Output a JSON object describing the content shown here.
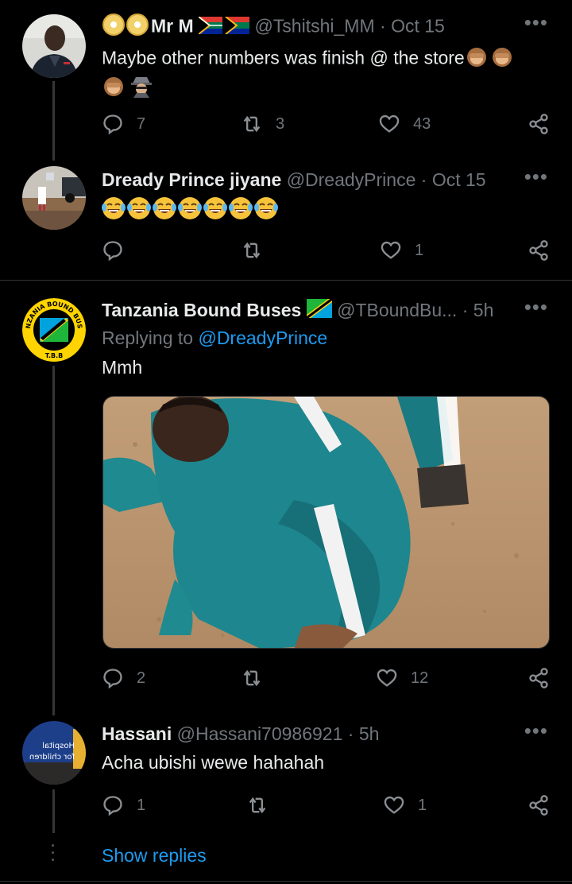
{
  "tweets": [
    {
      "name": "Mr M",
      "handle": "@Tshitshi_MM",
      "time": "Oct 15",
      "text": "Maybe other numbers was finish @ the store",
      "replies": "7",
      "retweets": "3",
      "likes": "43"
    },
    {
      "name": "Dready Prince jiyane",
      "handle": "@DreadyPrince",
      "time": "Oct 15",
      "replies": "",
      "retweets": "",
      "likes": "1"
    },
    {
      "name": "Tanzania Bound Buses",
      "handle": "@TBoundBu...",
      "time": "5h",
      "replying_prefix": "Replying to ",
      "replying_to": "@DreadyPrince",
      "text": "Mmh",
      "replies": "2",
      "retweets": "",
      "likes": "12"
    },
    {
      "name": "Hassani",
      "handle": "@Hassani70986921",
      "time": "5h",
      "text": "Acha ubishi wewe hahahah",
      "replies": "1",
      "retweets": "",
      "likes": "1"
    }
  ],
  "show_replies": "Show replies",
  "logo_text": {
    "top": "TANZANIA BOUND BUSES",
    "bottom": "T.B.B"
  },
  "avatar_sign_text": [
    "Hospital",
    "for children"
  ],
  "colors": {
    "background": "#000000",
    "link": "#1d9bf0",
    "muted": "#71767b",
    "divider": "#2f3336"
  },
  "icons": [
    "reply-icon",
    "retweet-icon",
    "like-icon",
    "share-icon",
    "more-icon"
  ]
}
